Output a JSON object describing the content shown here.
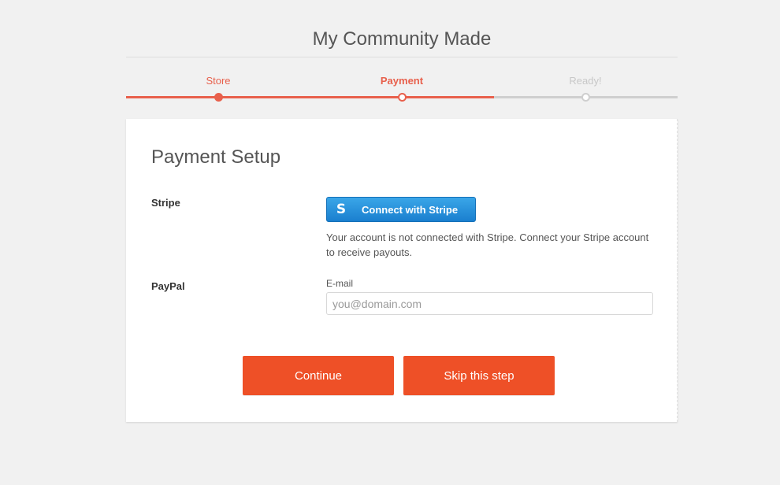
{
  "header": {
    "title": "My Community Made"
  },
  "steps": [
    {
      "label": "Store",
      "state": "done"
    },
    {
      "label": "Payment",
      "state": "active"
    },
    {
      "label": "Ready!",
      "state": "todo"
    }
  ],
  "card": {
    "title": "Payment Setup",
    "stripe": {
      "label": "Stripe",
      "button_icon": "S",
      "button_label": "Connect with Stripe",
      "help": "Your account is not connected with Stripe. Connect your Stripe account to receive payouts."
    },
    "paypal": {
      "label": "PayPal",
      "email_label": "E-mail",
      "email_value": "",
      "email_placeholder": "you@domain.com"
    },
    "actions": {
      "continue_label": "Continue",
      "skip_label": "Skip this step"
    }
  },
  "colors": {
    "accent": "#ee5027",
    "progress": "#e8604c",
    "stripe_blue": "#2b8fdc",
    "inactive": "#cfcfcf"
  }
}
